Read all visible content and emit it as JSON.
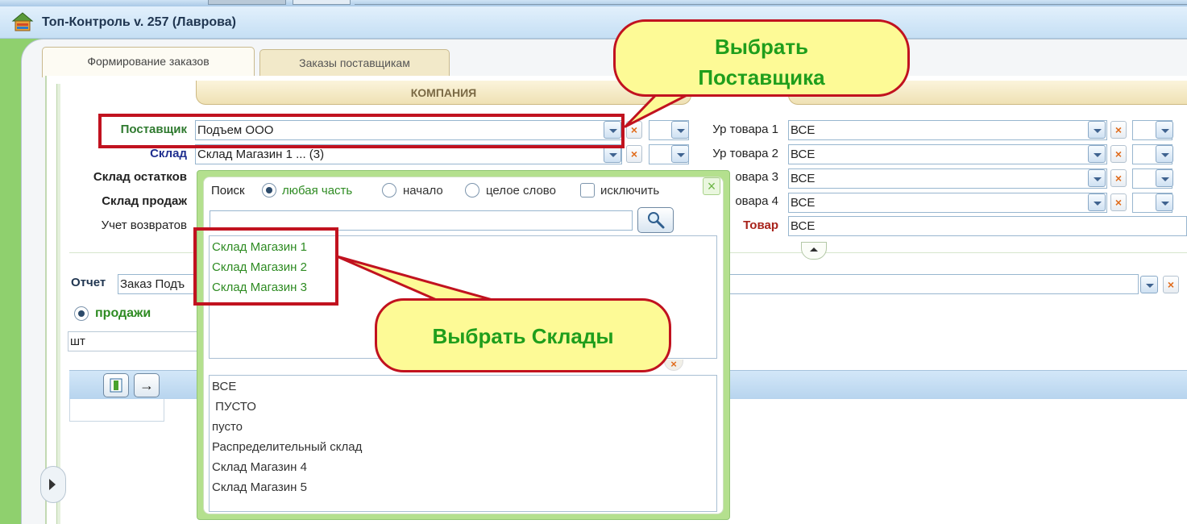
{
  "window": {
    "title": "Топ-Контроль v. 257 (Лаврова)"
  },
  "tabs": [
    "Формирование заказов",
    "Заказы поставщикам"
  ],
  "company": {
    "label": "КОМПАНИЯ"
  },
  "filters": {
    "supplier": {
      "label": "Поставщик",
      "value": "Подъем ООО"
    },
    "warehouse": {
      "label": "Склад",
      "value": "Склад Магазин 1 ... (3)"
    },
    "stock_warehouse": {
      "label": "Склад остатков"
    },
    "sales_warehouse": {
      "label": "Склад продаж"
    },
    "returns": {
      "label": "Учет возвратов"
    },
    "levels": [
      {
        "label": "Ур товара 1",
        "value": "ВСЕ"
      },
      {
        "label": "Ур товара 2",
        "value": "ВСЕ"
      },
      {
        "label": "овара 3",
        "value": "ВСЕ"
      },
      {
        "label": "овара 4",
        "value": "ВСЕ"
      }
    ],
    "product": {
      "label": "Товар",
      "value": "ВСЕ"
    }
  },
  "report": {
    "label": "Отчет",
    "value": "Заказ Подъ",
    "sales_option": "продажи",
    "unit": "шт"
  },
  "popup": {
    "search_label": "Поиск",
    "options": [
      "любая часть",
      "начало",
      "целое слово"
    ],
    "exclude": "исключить",
    "search_value": "",
    "selected_items": [
      "Склад Магазин 1",
      "Склад Магазин 2",
      "Склад Магазин 3"
    ],
    "available_items": [
      "ВСЕ",
      " ПУСТО",
      "пусто",
      "Распределительный склад",
      "Склад Магазин 4",
      "Склад Магазин 5"
    ]
  },
  "callouts": {
    "supplier": [
      "Выбрать",
      "Поставщика"
    ],
    "warehouses": "Выбрать Склады"
  },
  "icons": {
    "x": "×",
    "arrow_right": "→",
    "search": "search-icon"
  }
}
